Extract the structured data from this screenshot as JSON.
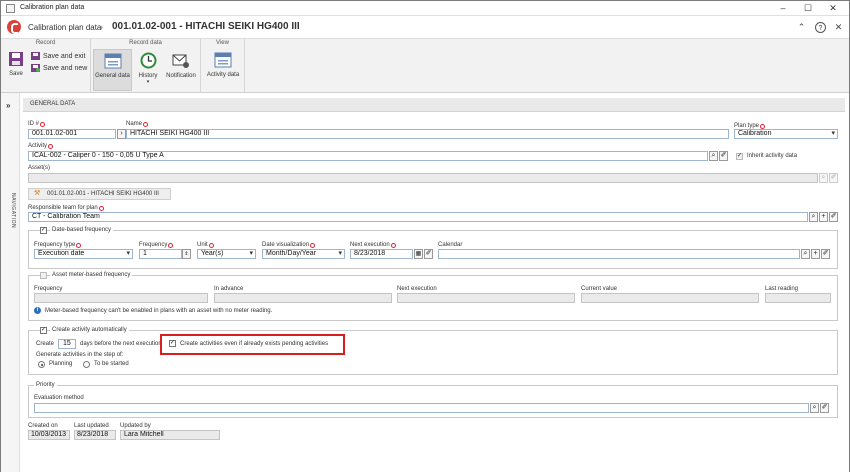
{
  "window": {
    "title": "Calibration plan data"
  },
  "header": {
    "app": "Calibration plan data",
    "record_title": "001.01.02-001 - HITACHI SEIKI HG400 III"
  },
  "ribbon": {
    "record_group": "Record",
    "record_data_group": "Record data",
    "view_group": "View",
    "save": "Save",
    "save_exit": "Save and exit",
    "save_new": "Save and new",
    "general_data": "General data",
    "history": "History",
    "notification": "Notification",
    "activity_data": "Activity data"
  },
  "nav": {
    "label": "NAVIGATION"
  },
  "general": {
    "section_title": "GENERAL DATA",
    "id_label": "ID #",
    "id_value": "001.01.02-001",
    "name_label": "Name",
    "name_value": "HITACHI SEIKI HG400 III",
    "plan_type_label": "Plan type",
    "plan_type_value": "Calibration",
    "activity_label": "Activity",
    "activity_value": "ICAL-002 - Caliper 0 - 150 - 0,05 U Type A",
    "inherit_label": "Inherit activity data",
    "assets_label": "Asset(s)",
    "asset_tag": "001.01.02-001 - HITACHI SEIKI HG400 III",
    "team_label": "Responsible team for plan",
    "team_value": "CT - Calibration Team"
  },
  "date_freq": {
    "title": "Date-based frequency",
    "freq_type_label": "Frequency type",
    "freq_type_value": "Execution date",
    "freq_label": "Frequency",
    "freq_value": "1",
    "unit_label": "Unit",
    "unit_value": "Year(s)",
    "date_vis_label": "Date visualization",
    "date_vis_value": "Month/Day/Year",
    "next_exec_label": "Next execution",
    "next_exec_value": "8/23/2018",
    "calendar_label": "Calendar",
    "calendar_value": ""
  },
  "meter_freq": {
    "title": "Asset meter-based frequency",
    "frequency_label": "Frequency",
    "in_advance_label": "In advance",
    "next_exec_label": "Next execution",
    "current_value_label": "Current value",
    "last_reading_label": "Last reading",
    "note": "Meter-based frequency can't be enabled in plans with an asset with no meter reading."
  },
  "auto": {
    "title": "Create activity automatically",
    "create_label": "Create",
    "days_value": "15",
    "days_label": "days before the next execution",
    "pending_label": "Create activities even if already exists pending activities",
    "step_label": "Generate activities in the step of:",
    "planning": "Planning",
    "to_be_started": "To be started"
  },
  "priority": {
    "title": "Priority",
    "eval_label": "Evaluation method",
    "eval_value": ""
  },
  "footer": {
    "created_label": "Created on",
    "created_value": "10/03/2013",
    "updated_label": "Last updated",
    "updated_value": "8/23/2018",
    "by_label": "Updated by",
    "by_value": "Lara Mitchell"
  },
  "colors": {
    "accent": "#d9413a",
    "highlight": "#d81e1e",
    "field_border": "#9db5cf"
  }
}
